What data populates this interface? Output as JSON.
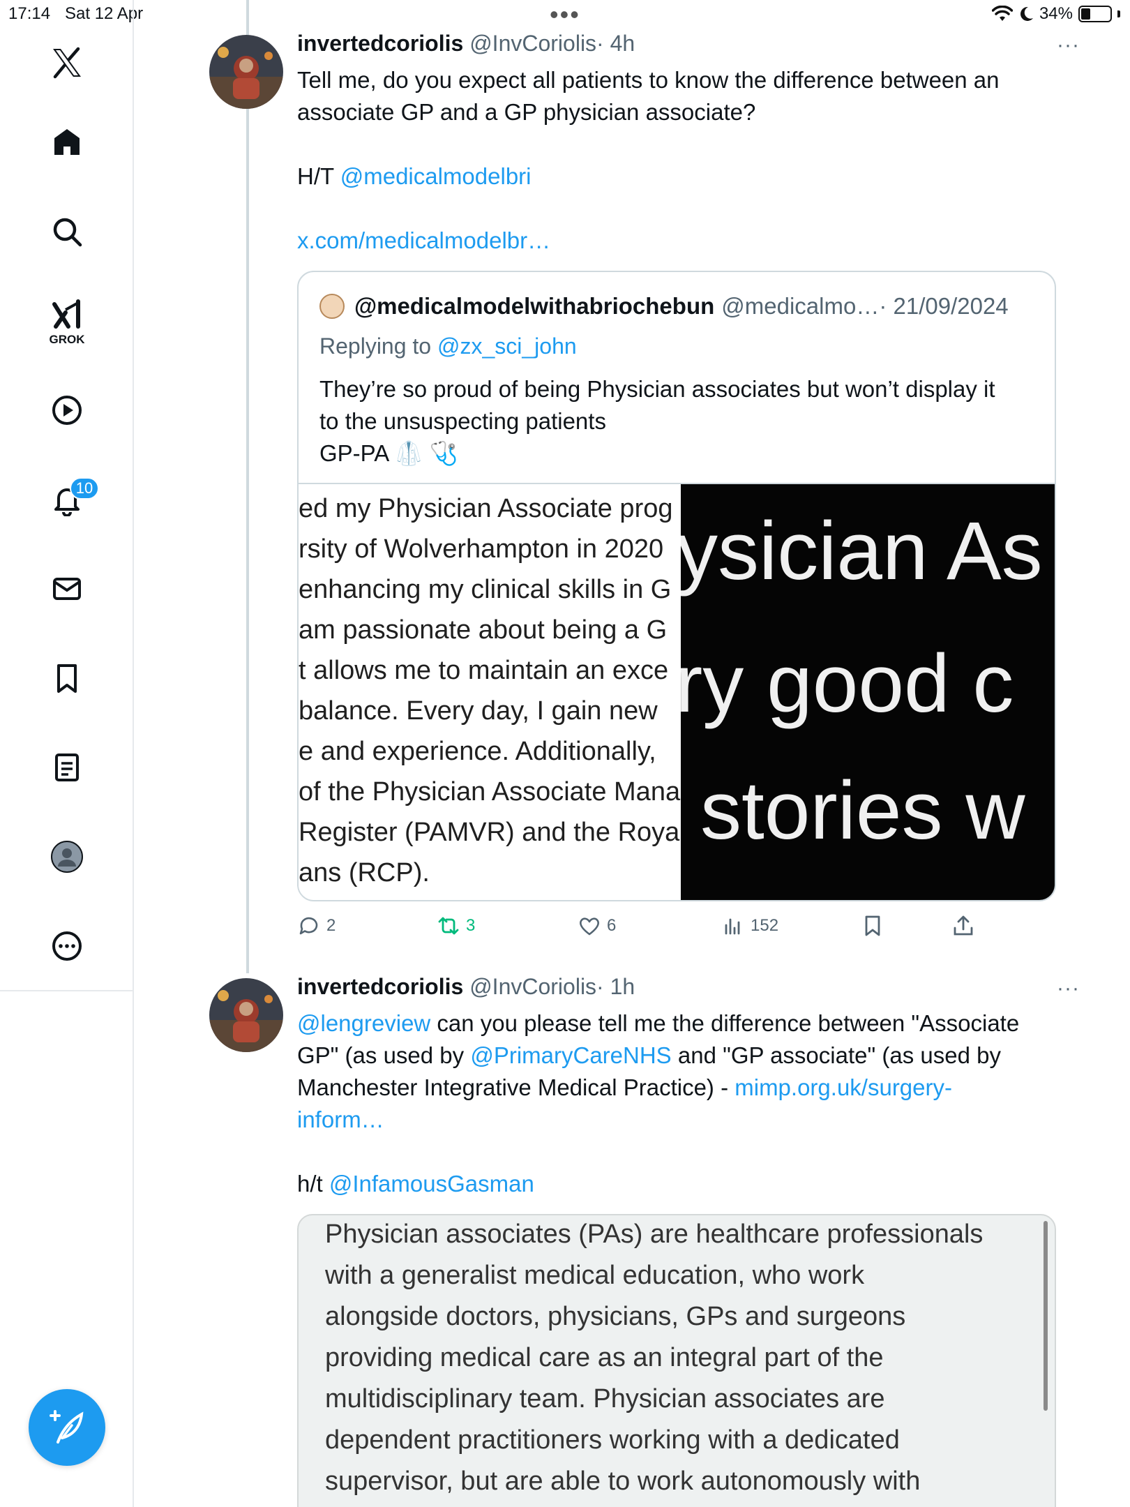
{
  "status_bar": {
    "time": "17:14",
    "date": "Sat 12 Apr",
    "dots": "•••",
    "battery": "34%"
  },
  "sidebar": {
    "grok_label": "GROK",
    "notification_count": "10",
    "items": [
      "x-logo",
      "home",
      "search",
      "grok",
      "video",
      "notifications",
      "messages",
      "bookmarks",
      "lists",
      "profile",
      "more"
    ]
  },
  "tweet1": {
    "name": "invertedcoriolis",
    "handle": "@InvCoriolis",
    "time": "· 4h",
    "more": "···",
    "text_line1": "Tell me, do you expect all patients to know the difference between an",
    "text_line2": "associate GP and a GP physician associate?",
    "ht_prefix": "H/T ",
    "ht_mention": "@medicalmodelbri",
    "link": "x.com/medicalmodelbr…",
    "quote": {
      "name": "@medicalmodelwithabriochebun",
      "handle": "@medicalmo…",
      "date": "· 21/09/2024",
      "replying_prefix": "Replying to ",
      "replying_to": "@zx_sci_john",
      "text_line1": "They’re so proud of being Physician associates but won’t display it",
      "text_line2": "to the unsuspecting patients",
      "text_line3": "GP-PA 🥼 🩺",
      "media_left": [
        "ed my Physician Associate prog",
        "rsity of Wolverhampton in 2020",
        "enhancing my clinical skills in G",
        " am passionate about being a G",
        "t allows me to maintain an exce",
        "balance. Every day, I gain new",
        "e and experience. Additionally,",
        "of the Physician Associate Mana",
        " Register (PAMVR) and the Roya",
        "ans (RCP)."
      ],
      "media_right": [
        "ysician As",
        "ry good c",
        "stories w"
      ]
    },
    "actions": {
      "replies": "2",
      "reposts": "3",
      "likes": "6",
      "views": "152"
    }
  },
  "tweet2": {
    "name": "invertedcoriolis",
    "handle": "@InvCoriolis",
    "time": "· 1h",
    "more": "···",
    "mention1": "@lengreview",
    "text_a": " can you please tell me the difference between \"Associate",
    "text_b": "GP\" (as used by ",
    "mention2": "@PrimaryCareNHS",
    "text_c": " and \"GP associate\" (as used by",
    "text_d": "Manchester Integrative Medical Practice) - ",
    "link_a": "mimp.org.uk/surgery-",
    "link_b": "inform…",
    "ht_prefix": "h/t ",
    "ht_mention": "@InfamousGasman",
    "image_lines": [
      "Physician associates (PAs) are healthcare professionals",
      "with a generalist medical education, who work",
      "alongside doctors, physicians, GPs and surgeons",
      "providing medical care as an integral part of the",
      "multidisciplinary team. Physician associates are",
      "dependent practitioners working with a dedicated",
      "supervisor, but are able to work autonomously with"
    ]
  },
  "colors": {
    "accent": "#1d9bf0",
    "repost_green": "#00ba7c",
    "text": "#0f1419",
    "muted": "#536471"
  }
}
